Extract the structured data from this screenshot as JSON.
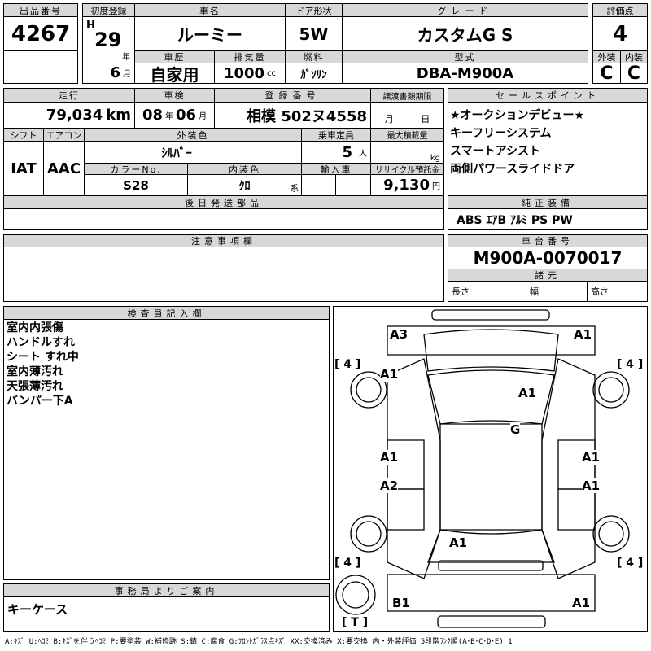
{
  "header": {
    "lot_label": "出品番号",
    "lot": "4267",
    "first_reg_label": "初度登録",
    "era": "H",
    "year": "29",
    "year_unit": "年",
    "month": "6",
    "month_unit": "月",
    "car_name_label": "車名",
    "car_name": "ルーミー",
    "door_label": "ドア形状",
    "door": "5W",
    "grade_label": "グレード",
    "grade": "カスタムG S",
    "history_label": "車歴",
    "history": "自家用",
    "displacement_label": "排気量",
    "displacement": "1000",
    "displacement_unit": "cc",
    "fuel_label": "燃料",
    "fuel": "ｶﾞｿﾘﾝ",
    "model_label": "型式",
    "model": "DBA-M900A",
    "score_label": "評価点",
    "score": "4",
    "exterior_label": "外装",
    "exterior": "C",
    "interior_label": "内装",
    "interior": "C"
  },
  "details": {
    "mileage_label": "走行",
    "mileage": "79,034",
    "mileage_unit": "km",
    "inspection_label": "車検",
    "insp_year": "08",
    "insp_year_unit": "年",
    "insp_month": "06",
    "insp_month_unit": "月",
    "plate_label": "登録番号",
    "plate": "相模 502ヌ4558",
    "doc_deadline_label": "譲渡書類期限",
    "doc_month_unit": "月",
    "doc_day_unit": "日",
    "shift_label": "シフト",
    "shift": "IAT",
    "ac_label": "エアコン",
    "ac": "AAC",
    "color_label": "外装色",
    "color": "ｼﾙﾊﾞｰ",
    "capacity_label": "乗車定員",
    "capacity": "5",
    "capacity_unit": "人",
    "max_load_label": "最大積載量",
    "max_load_unit": "kg",
    "color_no_label": "カラーNo.",
    "color_no": "S28",
    "interior_color_label": "内装色",
    "interior_color": "ｸﾛ",
    "interior_color_unit": "系",
    "import_label": "輸入車",
    "recycle_label": "リサイクル預託金",
    "recycle": "9,130",
    "recycle_unit": "円",
    "later_parts_label": "後日発送部品"
  },
  "sales": {
    "label": "セールスポイント",
    "points": [
      "★オークションデビュー★",
      "キーフリーシステム",
      "スマートアシスト",
      "両側パワースライドドア"
    ]
  },
  "equipment": {
    "label": "純正装備",
    "value": "ABS ｴｱB ｱﾙﾐ PS PW"
  },
  "notes": {
    "label": "注意事項欄"
  },
  "chassis": {
    "label": "車台番号",
    "value": "M900A-0070017",
    "spec_label": "諸元",
    "length": "長さ",
    "width": "幅",
    "height": "高さ"
  },
  "inspector": {
    "label": "検査員記入欄",
    "items": [
      "室内内張傷",
      "ハンドルすれ",
      "シート すれ中",
      "室内薄汚れ",
      "天張薄汚れ",
      "バンパー下A"
    ]
  },
  "office": {
    "label": "事務局よりご案内",
    "value": "キーケース"
  },
  "diagram": {
    "marks": [
      "A3",
      "A1",
      "A1",
      "A1",
      "G",
      "A1",
      "A1",
      "A2",
      "A1",
      "A1",
      "B1",
      "A1"
    ],
    "tire": "[ 4 ]",
    "spare": "[ T ]"
  },
  "legend": "A:ｷｽﾞ U:ﾍｺﾐ B:ｷｽﾞを伴うﾍｺﾐ P:要塗装 W:補修跡 S:錆 C:腐食 G:ﾌﾛﾝﾄｶﾞﾗｽ点ｷｽﾞ XX:交換済み X:要交換  内・外装評価  5段階ﾗﾝｸ順(A･B･C･D･E) 1"
}
